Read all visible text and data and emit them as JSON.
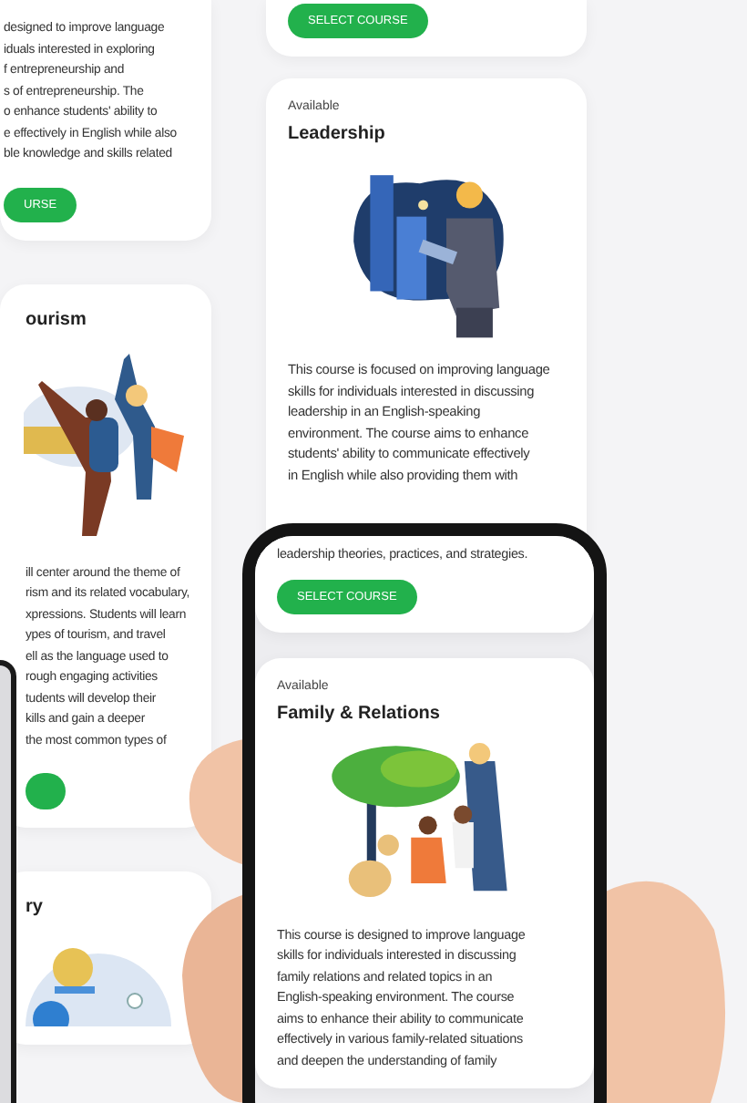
{
  "left_column": [
    {
      "lines": [
        "designed to improve language",
        "iduals interested in exploring",
        "f entrepreneurship and",
        "s of entrepreneurship. The",
        "o enhance students' ability to",
        "e effectively in English while also",
        "ble knowledge and skills related"
      ],
      "button": "URSE"
    },
    {
      "title": "ourism",
      "kind": "tourism",
      "lines": [
        "ill center around the theme of",
        "rism and its related vocabulary,",
        "xpressions. Students will learn",
        "ypes of tourism, and travel",
        "ell as the language used to",
        "rough engaging activities",
        "tudents will develop their",
        "kills and gain a deeper",
        "the most common types of"
      ],
      "has_button": true
    },
    {
      "title": "ry",
      "kind": "coin"
    }
  ],
  "middle_column": [
    {
      "button": "SELECT COURSE"
    },
    {
      "status": "Available",
      "title": "Leadership",
      "kind": "leadership",
      "lines": [
        "This course is focused on improving language",
        "skills for individuals interested in discussing",
        "leadership in an English-speaking",
        "environment. The course aims to enhance",
        "students' ability to communicate effectively",
        "in English while also providing them with"
      ]
    }
  ],
  "phone_screen": [
    {
      "lines": [
        "leadership theories, practices, and strategies."
      ],
      "button": "SELECT COURSE"
    },
    {
      "status": "Available",
      "title": "Family & Relations",
      "kind": "family",
      "lines": [
        "This course is designed to improve language",
        "skills for individuals interested in discussing",
        "family relations and related topics in an",
        "English-speaking environment. The course",
        "aims to enhance their ability to communicate",
        "effectively in various family-related situations",
        "and deepen the understanding of family"
      ]
    }
  ]
}
